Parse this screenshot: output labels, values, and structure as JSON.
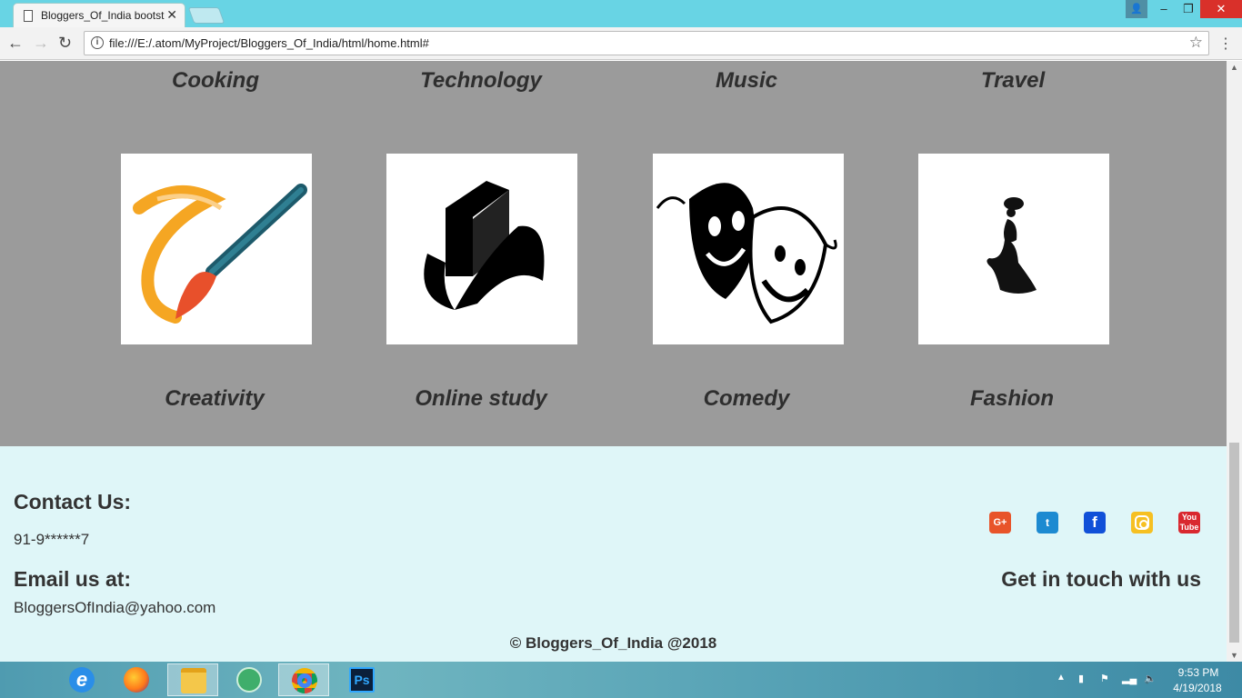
{
  "browser": {
    "tab_title": "Bloggers_Of_India bootst",
    "url": "file:///E:/.atom/MyProject/Bloggers_Of_India/html/home.html#",
    "window_controls": [
      "–",
      "❐",
      "✕"
    ]
  },
  "categories_top": [
    "Cooking",
    "Technology",
    "Music",
    "Travel"
  ],
  "categories_bottom": [
    "Creativity",
    "Online study",
    "Comedy",
    "Fashion"
  ],
  "category_images": [
    "paint-brush-icon",
    "book-icon",
    "comedy-masks-icon",
    "fashion-lady-icon"
  ],
  "footer": {
    "contact_title": "Contact Us:",
    "phone": "91-9******7",
    "email_title": "Email us at:",
    "email": "BloggersOfIndia@yahoo.com",
    "get_in_touch": "Get in touch with us",
    "copyright": "© Bloggers_Of_India @2018",
    "social": [
      {
        "name": "google-plus-icon",
        "glyph": "G+",
        "color": "#e8542a"
      },
      {
        "name": "twitter-icon",
        "glyph": "t",
        "color": "#1d8ad1"
      },
      {
        "name": "facebook-icon",
        "glyph": "f",
        "color": "#1150d8"
      },
      {
        "name": "instagram-icon",
        "glyph": "",
        "color": "#f6c022"
      },
      {
        "name": "youtube-icon",
        "glyph": "You Tube",
        "color": "#d9282f"
      }
    ]
  },
  "colors": {
    "categories_bg": "#9b9b9b",
    "footer_bg": "#dff6f8",
    "titlebar_bg": "#68d4e4"
  },
  "taskbar": {
    "apps": [
      "internet-explorer-icon",
      "firefox-icon",
      "file-explorer-icon",
      "atom-icon",
      "chrome-icon",
      "photoshop-icon"
    ],
    "photoshop_label": "Ps",
    "time": "9:53 PM",
    "date": "4/19/2018"
  }
}
